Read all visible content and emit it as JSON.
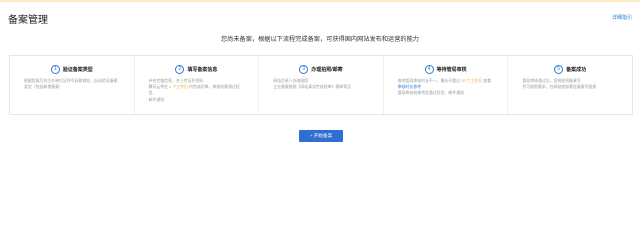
{
  "header": {
    "title": "备案管理",
    "detail_link": "详细指引"
  },
  "subtitle": "您尚未备案，根据以下流程完成备案，可获得国内网站发布和运营的能力",
  "steps": [
    {
      "num": "1",
      "title": "验证备案类型",
      "lines": [
        "根据您填写的主办单位证件号码和域名，自动验证备案",
        "类型（包括新增备案）"
      ],
      "inline": null
    },
    {
      "num": "2",
      "title": "填写备案信息",
      "lines": [
        "补充完整信息，并上传证件资料"
      ],
      "inline": {
        "before": "腾讯云将在 ",
        "highlight": "1 个工作日",
        "after": " 内完成初审，审核结果通过短信、"
      },
      "lines_after": [
        "邮件通知"
      ]
    },
    {
      "num": "3",
      "title": "办理拍照/邮寄",
      "lines": [
        "网站负责人办理拍照",
        "企业备案根据《网站真实性核验单》需邮寄至"
      ],
      "inline": null
    },
    {
      "num": "4",
      "title": "等待管局审核",
      "lines": [],
      "inline": {
        "before": "各地管局审核时长不一，最长不超过 ",
        "highlight": "20 个工作日",
        "after": " 查看",
        "link": "审核时长参考"
      },
      "lines_after": [
        "管局审核结果将会通过短信、邮件通知"
      ]
    },
    {
      "num": "5",
      "title": "备案成功",
      "lines": [
        "管局审核通过后，您将收到备案号",
        "并可按照要求，在网站底部悬挂备案号链接"
      ],
      "inline": null
    }
  ],
  "start_button": "+ 开始备案"
}
